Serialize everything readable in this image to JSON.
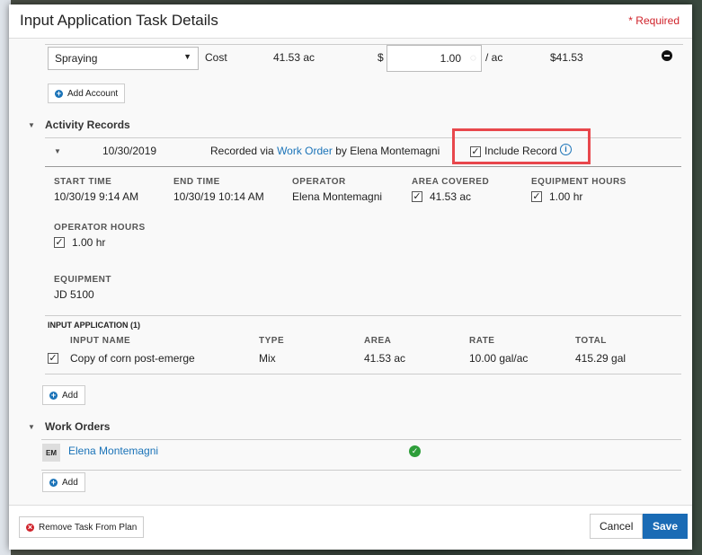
{
  "modal": {
    "title": "Input Application Task Details",
    "required": "* Required"
  },
  "cost": {
    "account": "Spraying",
    "label": "Cost",
    "area": "41.53 ac",
    "currency": "$",
    "rate": "1.00",
    "unit": "/ ac",
    "total": "$41.53",
    "add_account": "Add Account"
  },
  "activity": {
    "title": "Activity Records",
    "date": "10/30/2019",
    "recorded_prefix": "Recorded via",
    "recorded_link": "Work Order",
    "recorded_by": "by Elena Montemagni",
    "include_record": "Include Record",
    "include_checked": true,
    "fields": {
      "start_time_label": "START TIME",
      "start_time": "10/30/19 9:14 AM",
      "end_time_label": "END TIME",
      "end_time": "10/30/19 10:14 AM",
      "operator_label": "OPERATOR",
      "operator": "Elena Montemagni",
      "area_label": "AREA COVERED",
      "area": "41.53 ac",
      "eq_hours_label": "EQUIPMENT HOURS",
      "eq_hours": "1.00 hr",
      "op_hours_label": "OPERATOR HOURS",
      "op_hours": "1.00 hr",
      "equipment_label": "EQUIPMENT",
      "equipment": "JD 5100"
    },
    "input_app": {
      "title": "INPUT APPLICATION (1)",
      "columns": [
        "INPUT NAME",
        "TYPE",
        "AREA",
        "RATE",
        "TOTAL"
      ],
      "rows": [
        [
          "Copy of corn post-emerge",
          "Mix",
          "41.53 ac",
          "10.00 gal/ac",
          "415.29 gal"
        ]
      ],
      "add": "Add"
    }
  },
  "work_orders": {
    "title": "Work Orders",
    "initials": "EM",
    "name": "Elena Montemagni",
    "add": "Add"
  },
  "footer": {
    "remove": "Remove Task From Plan",
    "cancel": "Cancel",
    "save": "Save"
  },
  "colors": {
    "accent": "#1a73b8",
    "highlight": "#e8474c",
    "success": "#2e9e3a"
  }
}
